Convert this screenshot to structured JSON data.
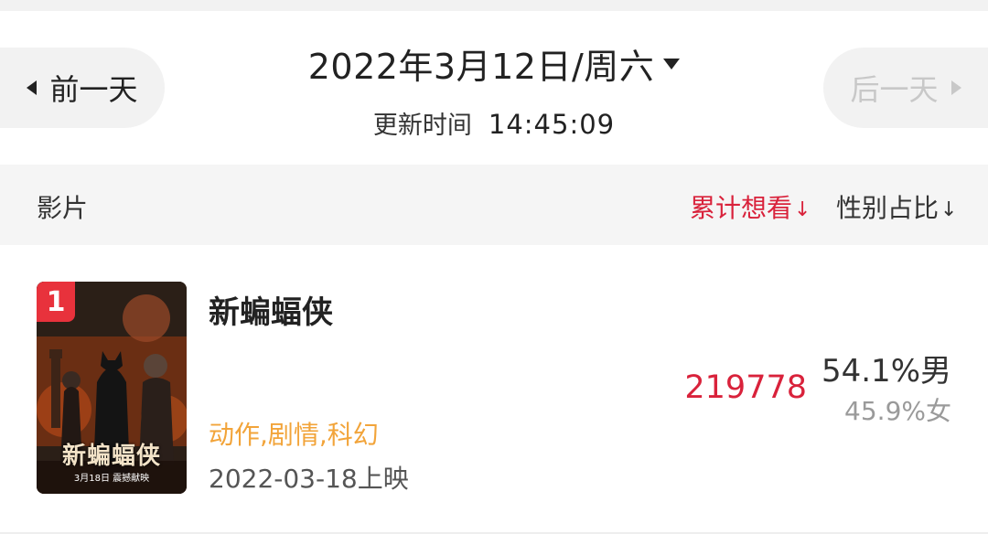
{
  "header": {
    "prev_label": "前一天",
    "next_label": "后一天",
    "date_title": "2022年3月12日/周六",
    "update_label": "更新时间",
    "update_time": "14:45:09"
  },
  "columns": {
    "movie": "影片",
    "want": "累计想看",
    "gender": "性别占比",
    "sort_glyph": "↓"
  },
  "movies": [
    {
      "rank": "1",
      "name": "新蝙蝠侠",
      "poster_title": "新蝙蝠侠",
      "poster_date": "3月18日 震撼献映",
      "genres": "动作,剧情,科幻",
      "release": "2022-03-18上映",
      "want_count": "219778",
      "male_pct": "54.1%男",
      "female_pct": "45.9%女"
    }
  ],
  "colors": {
    "accent_red": "#d9223b",
    "genre_orange": "#f2a43a",
    "badge_red": "#e8323c"
  }
}
